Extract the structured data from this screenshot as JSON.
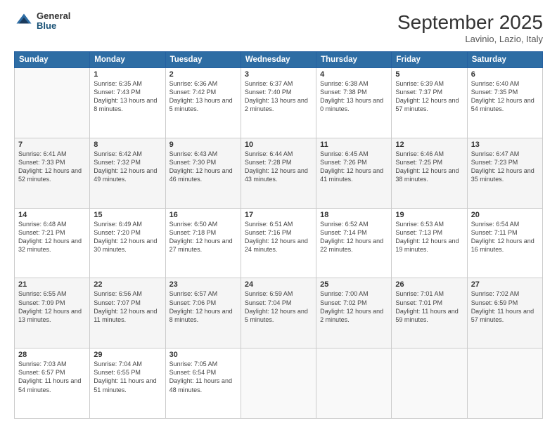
{
  "header": {
    "logo": {
      "general": "General",
      "blue": "Blue"
    },
    "title": "September 2025",
    "subtitle": "Lavinio, Lazio, Italy"
  },
  "weekdays": [
    "Sunday",
    "Monday",
    "Tuesday",
    "Wednesday",
    "Thursday",
    "Friday",
    "Saturday"
  ],
  "weeks": [
    [
      {
        "day": "",
        "sunrise": "",
        "sunset": "",
        "daylight": ""
      },
      {
        "day": "1",
        "sunrise": "Sunrise: 6:35 AM",
        "sunset": "Sunset: 7:43 PM",
        "daylight": "Daylight: 13 hours and 8 minutes."
      },
      {
        "day": "2",
        "sunrise": "Sunrise: 6:36 AM",
        "sunset": "Sunset: 7:42 PM",
        "daylight": "Daylight: 13 hours and 5 minutes."
      },
      {
        "day": "3",
        "sunrise": "Sunrise: 6:37 AM",
        "sunset": "Sunset: 7:40 PM",
        "daylight": "Daylight: 13 hours and 2 minutes."
      },
      {
        "day": "4",
        "sunrise": "Sunrise: 6:38 AM",
        "sunset": "Sunset: 7:38 PM",
        "daylight": "Daylight: 13 hours and 0 minutes."
      },
      {
        "day": "5",
        "sunrise": "Sunrise: 6:39 AM",
        "sunset": "Sunset: 7:37 PM",
        "daylight": "Daylight: 12 hours and 57 minutes."
      },
      {
        "day": "6",
        "sunrise": "Sunrise: 6:40 AM",
        "sunset": "Sunset: 7:35 PM",
        "daylight": "Daylight: 12 hours and 54 minutes."
      }
    ],
    [
      {
        "day": "7",
        "sunrise": "Sunrise: 6:41 AM",
        "sunset": "Sunset: 7:33 PM",
        "daylight": "Daylight: 12 hours and 52 minutes."
      },
      {
        "day": "8",
        "sunrise": "Sunrise: 6:42 AM",
        "sunset": "Sunset: 7:32 PM",
        "daylight": "Daylight: 12 hours and 49 minutes."
      },
      {
        "day": "9",
        "sunrise": "Sunrise: 6:43 AM",
        "sunset": "Sunset: 7:30 PM",
        "daylight": "Daylight: 12 hours and 46 minutes."
      },
      {
        "day": "10",
        "sunrise": "Sunrise: 6:44 AM",
        "sunset": "Sunset: 7:28 PM",
        "daylight": "Daylight: 12 hours and 43 minutes."
      },
      {
        "day": "11",
        "sunrise": "Sunrise: 6:45 AM",
        "sunset": "Sunset: 7:26 PM",
        "daylight": "Daylight: 12 hours and 41 minutes."
      },
      {
        "day": "12",
        "sunrise": "Sunrise: 6:46 AM",
        "sunset": "Sunset: 7:25 PM",
        "daylight": "Daylight: 12 hours and 38 minutes."
      },
      {
        "day": "13",
        "sunrise": "Sunrise: 6:47 AM",
        "sunset": "Sunset: 7:23 PM",
        "daylight": "Daylight: 12 hours and 35 minutes."
      }
    ],
    [
      {
        "day": "14",
        "sunrise": "Sunrise: 6:48 AM",
        "sunset": "Sunset: 7:21 PM",
        "daylight": "Daylight: 12 hours and 32 minutes."
      },
      {
        "day": "15",
        "sunrise": "Sunrise: 6:49 AM",
        "sunset": "Sunset: 7:20 PM",
        "daylight": "Daylight: 12 hours and 30 minutes."
      },
      {
        "day": "16",
        "sunrise": "Sunrise: 6:50 AM",
        "sunset": "Sunset: 7:18 PM",
        "daylight": "Daylight: 12 hours and 27 minutes."
      },
      {
        "day": "17",
        "sunrise": "Sunrise: 6:51 AM",
        "sunset": "Sunset: 7:16 PM",
        "daylight": "Daylight: 12 hours and 24 minutes."
      },
      {
        "day": "18",
        "sunrise": "Sunrise: 6:52 AM",
        "sunset": "Sunset: 7:14 PM",
        "daylight": "Daylight: 12 hours and 22 minutes."
      },
      {
        "day": "19",
        "sunrise": "Sunrise: 6:53 AM",
        "sunset": "Sunset: 7:13 PM",
        "daylight": "Daylight: 12 hours and 19 minutes."
      },
      {
        "day": "20",
        "sunrise": "Sunrise: 6:54 AM",
        "sunset": "Sunset: 7:11 PM",
        "daylight": "Daylight: 12 hours and 16 minutes."
      }
    ],
    [
      {
        "day": "21",
        "sunrise": "Sunrise: 6:55 AM",
        "sunset": "Sunset: 7:09 PM",
        "daylight": "Daylight: 12 hours and 13 minutes."
      },
      {
        "day": "22",
        "sunrise": "Sunrise: 6:56 AM",
        "sunset": "Sunset: 7:07 PM",
        "daylight": "Daylight: 12 hours and 11 minutes."
      },
      {
        "day": "23",
        "sunrise": "Sunrise: 6:57 AM",
        "sunset": "Sunset: 7:06 PM",
        "daylight": "Daylight: 12 hours and 8 minutes."
      },
      {
        "day": "24",
        "sunrise": "Sunrise: 6:59 AM",
        "sunset": "Sunset: 7:04 PM",
        "daylight": "Daylight: 12 hours and 5 minutes."
      },
      {
        "day": "25",
        "sunrise": "Sunrise: 7:00 AM",
        "sunset": "Sunset: 7:02 PM",
        "daylight": "Daylight: 12 hours and 2 minutes."
      },
      {
        "day": "26",
        "sunrise": "Sunrise: 7:01 AM",
        "sunset": "Sunset: 7:01 PM",
        "daylight": "Daylight: 11 hours and 59 minutes."
      },
      {
        "day": "27",
        "sunrise": "Sunrise: 7:02 AM",
        "sunset": "Sunset: 6:59 PM",
        "daylight": "Daylight: 11 hours and 57 minutes."
      }
    ],
    [
      {
        "day": "28",
        "sunrise": "Sunrise: 7:03 AM",
        "sunset": "Sunset: 6:57 PM",
        "daylight": "Daylight: 11 hours and 54 minutes."
      },
      {
        "day": "29",
        "sunrise": "Sunrise: 7:04 AM",
        "sunset": "Sunset: 6:55 PM",
        "daylight": "Daylight: 11 hours and 51 minutes."
      },
      {
        "day": "30",
        "sunrise": "Sunrise: 7:05 AM",
        "sunset": "Sunset: 6:54 PM",
        "daylight": "Daylight: 11 hours and 48 minutes."
      },
      {
        "day": "",
        "sunrise": "",
        "sunset": "",
        "daylight": ""
      },
      {
        "day": "",
        "sunrise": "",
        "sunset": "",
        "daylight": ""
      },
      {
        "day": "",
        "sunrise": "",
        "sunset": "",
        "daylight": ""
      },
      {
        "day": "",
        "sunrise": "",
        "sunset": "",
        "daylight": ""
      }
    ]
  ]
}
